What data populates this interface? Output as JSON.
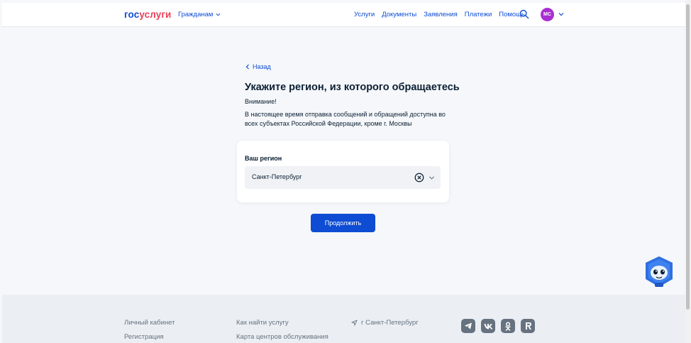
{
  "header": {
    "logo_part1": "гос",
    "logo_part2": "услуги",
    "citizens_label": "Гражданам",
    "nav": [
      "Услуги",
      "Документы",
      "Заявления",
      "Платежи",
      "Помощь"
    ],
    "avatar_initials": "МС"
  },
  "main": {
    "back_label": "Назад",
    "title": "Укажите регион, из которого обращаетесь",
    "attention": "Внимание!",
    "notice": "В настоящее время отправка сообщений и обращений доступна во всех субъектах Российской Федерации, кроме г. Москвы",
    "region_label": "Ваш регион",
    "region_value": "Санкт-Петербург",
    "continue_label": "Продолжить"
  },
  "footer": {
    "col1": [
      "Личный кабинет",
      "Регистрация"
    ],
    "col2": [
      "Как найти услугу",
      "Карта центров обслуживания"
    ],
    "city": "г Санкт-Петербург",
    "socials": [
      "telegram-icon",
      "vk-icon",
      "odnoklassniki-icon",
      "rutube-icon"
    ]
  },
  "colors": {
    "accent": "#0d4cd3",
    "logo_red": "#ee3f58",
    "avatar": "#a92fd1"
  }
}
